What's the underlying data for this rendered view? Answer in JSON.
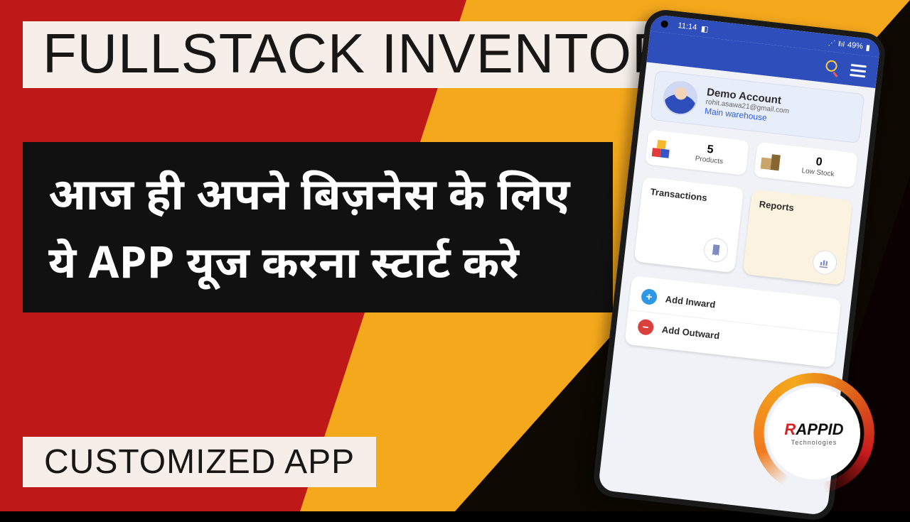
{
  "title": "FULLSTACK INVENTORY",
  "subtitle_hi": "आज ही  अपने बिज़नेस के लिए ये APP यूज करना स्टार्ट करे",
  "customized": "CUSTOMIZED APP",
  "status": {
    "time": "11:14",
    "battery": "49%",
    "battery_icon": "▮"
  },
  "profile": {
    "name": "Demo Account",
    "email": "rohit.asawa21@gmail.com",
    "warehouse": "Main warehouse"
  },
  "stats": {
    "products_value": "5",
    "products_label": "Products",
    "lowstock_value": "0",
    "lowstock_label": "Low Stock"
  },
  "cards": {
    "transactions": "Transactions",
    "reports": "Reports"
  },
  "actions": {
    "inward": "Add Inward",
    "outward": "Add Outward"
  },
  "logo": {
    "line1_r": "R",
    "line1_rest": "APPID",
    "line2": "Technologies"
  }
}
